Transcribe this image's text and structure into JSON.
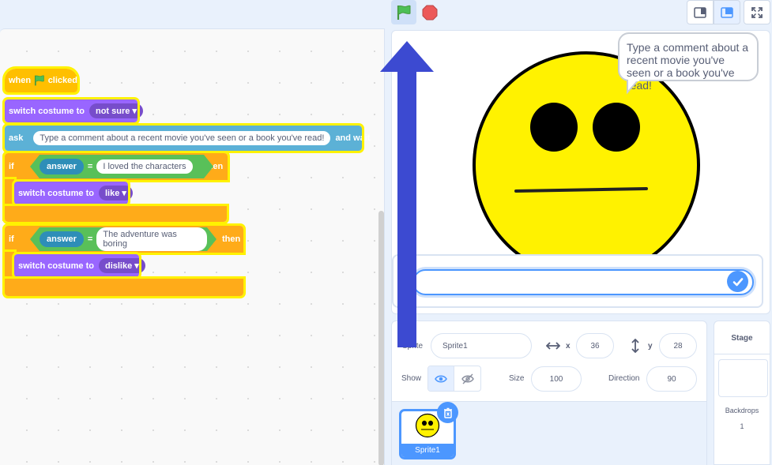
{
  "controls": {
    "green_flag": "green-flag-icon",
    "stop": "stop-icon",
    "small_stage": "small-stage-icon",
    "normal_stage": "normal-stage-icon",
    "fullscreen": "fullscreen-icon"
  },
  "code": {
    "hat": {
      "when": "when",
      "flag_icon": "green-flag-icon",
      "clicked": "clicked"
    },
    "switch1": {
      "label": "switch costume to",
      "value": "not sure"
    },
    "ask": {
      "label": "ask",
      "question": "Type a comment about a recent movie you've seen or a book you've read!",
      "suffix": "and wait"
    },
    "if1": {
      "label": "if",
      "reporter": "answer",
      "op": "=",
      "value": "I loved the characters",
      "then": "then"
    },
    "switch2": {
      "label": "switch costume to",
      "value": "like"
    },
    "if2": {
      "label": "if",
      "reporter": "answer",
      "op": "=",
      "value": "The adventure was boring",
      "then": "then"
    },
    "switch3": {
      "label": "switch costume to",
      "value": "dislike"
    }
  },
  "stage": {
    "speech": "Type a comment about a recent movie you've seen or a book you've read!",
    "answer_value": "",
    "submit_icon": "check-icon"
  },
  "sprite_info": {
    "sprite_label": "Sprite",
    "sprite_name": "Sprite1",
    "x_label": "x",
    "x_value": "36",
    "y_label": "y",
    "y_value": "28",
    "show_label": "Show",
    "size_label": "Size",
    "size_value": "100",
    "direction_label": "Direction",
    "direction_value": "90"
  },
  "sprite_list": {
    "items": [
      {
        "name": "Sprite1"
      }
    ]
  },
  "stage_pane": {
    "title": "Stage",
    "backdrops_label": "Backdrops",
    "backdrops_count": "1"
  },
  "colors": {
    "motion_blue": "#4c97ff",
    "events": "#ffbf00",
    "looks": "#9966ff",
    "sensing": "#5cb1d6",
    "control": "#ffab19",
    "operators": "#59c059",
    "highlight": "#fff200",
    "arrow": "#3c4ad1"
  }
}
